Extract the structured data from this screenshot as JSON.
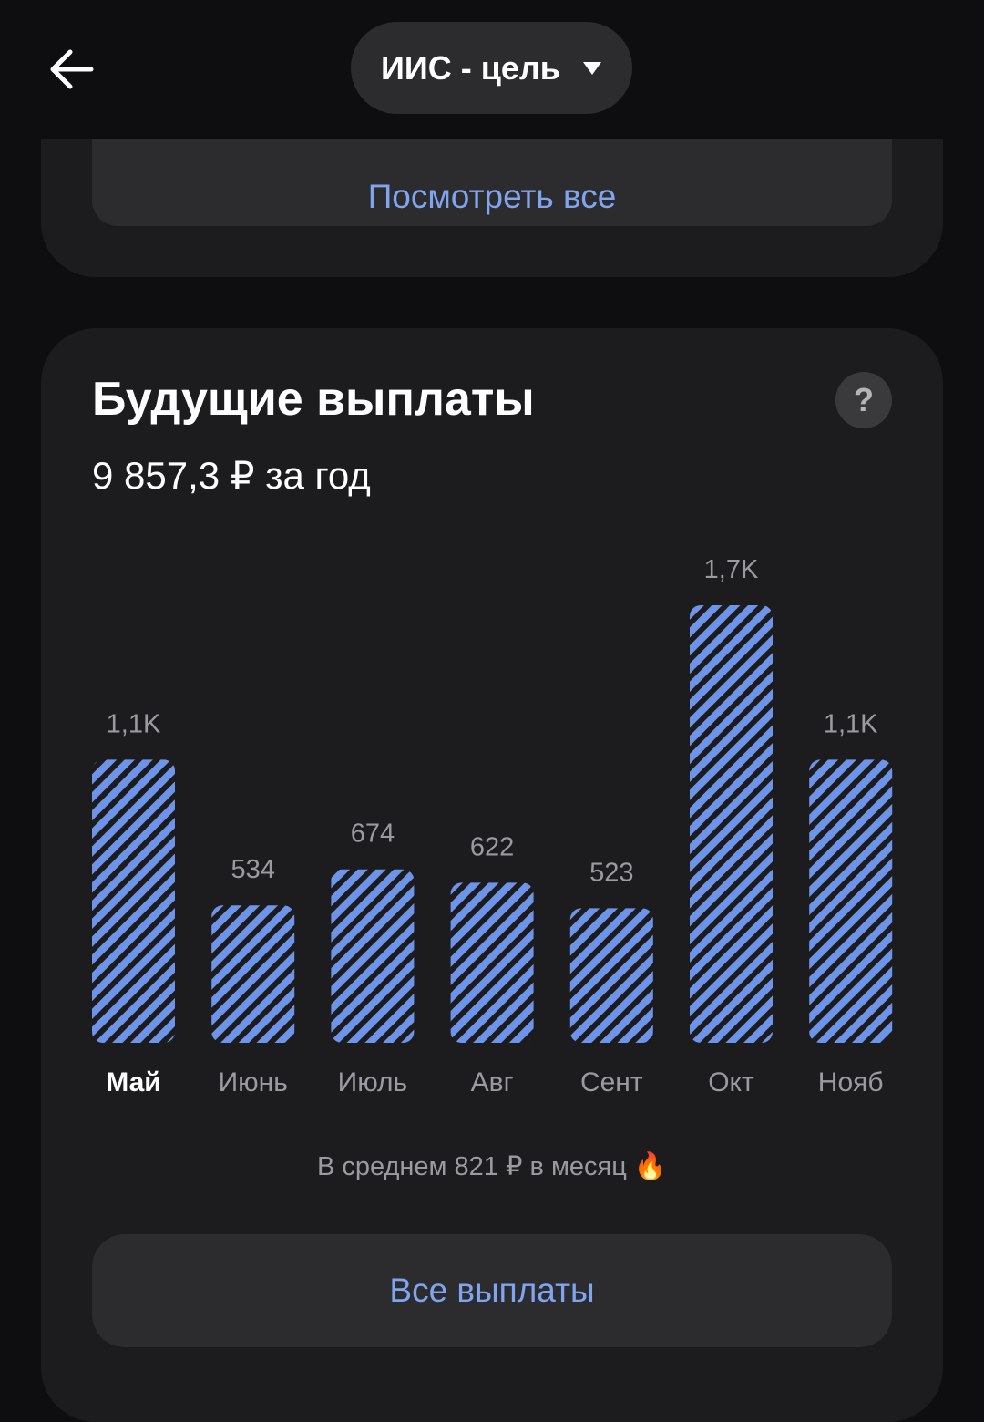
{
  "header": {
    "account_label": "ИИС - цель"
  },
  "top_card": {
    "view_all_label": "Посмотреть все"
  },
  "payouts": {
    "title": "Будущие выплаты",
    "total": "9 857,3 ₽ за год",
    "average": "В среднем 821 ₽ в месяц 🔥",
    "all_payouts_label": "Все выплаты"
  },
  "colors": {
    "accent": "#7fa4f0",
    "bar_stripe": "#6d94e8",
    "card_bg": "#1c1c1f",
    "button_bg": "#2c2c2f"
  },
  "chart_data": {
    "type": "bar",
    "categories": [
      "Май",
      "Июнь",
      "Июль",
      "Авг",
      "Сент",
      "Окт",
      "Нояб"
    ],
    "values": [
      1100,
      534,
      674,
      622,
      523,
      1700,
      1100
    ],
    "value_labels": [
      "1,1K",
      "534",
      "674",
      "622",
      "523",
      "1,7K",
      "1,1K"
    ],
    "selected_category": "Май",
    "pattern": "diagonal-stripes"
  }
}
